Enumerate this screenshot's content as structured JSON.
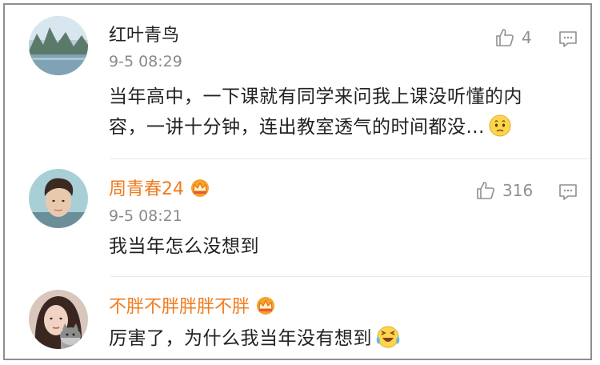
{
  "comments": [
    {
      "name": "红叶青鸟",
      "time": "9-5 08:29",
      "text_line1": "当年高中，一下课就有同学来问我上课没听懂的内",
      "text_line2": "容，一讲十分钟，连出教室透气的时间都没...",
      "likes": "4"
    },
    {
      "name": "周青春24",
      "time": "9-5 08:21",
      "text": "我当年怎么没想到",
      "likes": "316"
    },
    {
      "name": "不胖不胖胖胖不胖",
      "text": "厉害了，为什么我当年没有想到"
    }
  ],
  "colors": {
    "vip_name": "#f07b1d",
    "plain_name": "#222222",
    "meta": "#8a8a8a"
  },
  "icons": {
    "like": "thumbs-up-icon",
    "reply": "comment-icon",
    "vip": "crown-badge-icon"
  }
}
